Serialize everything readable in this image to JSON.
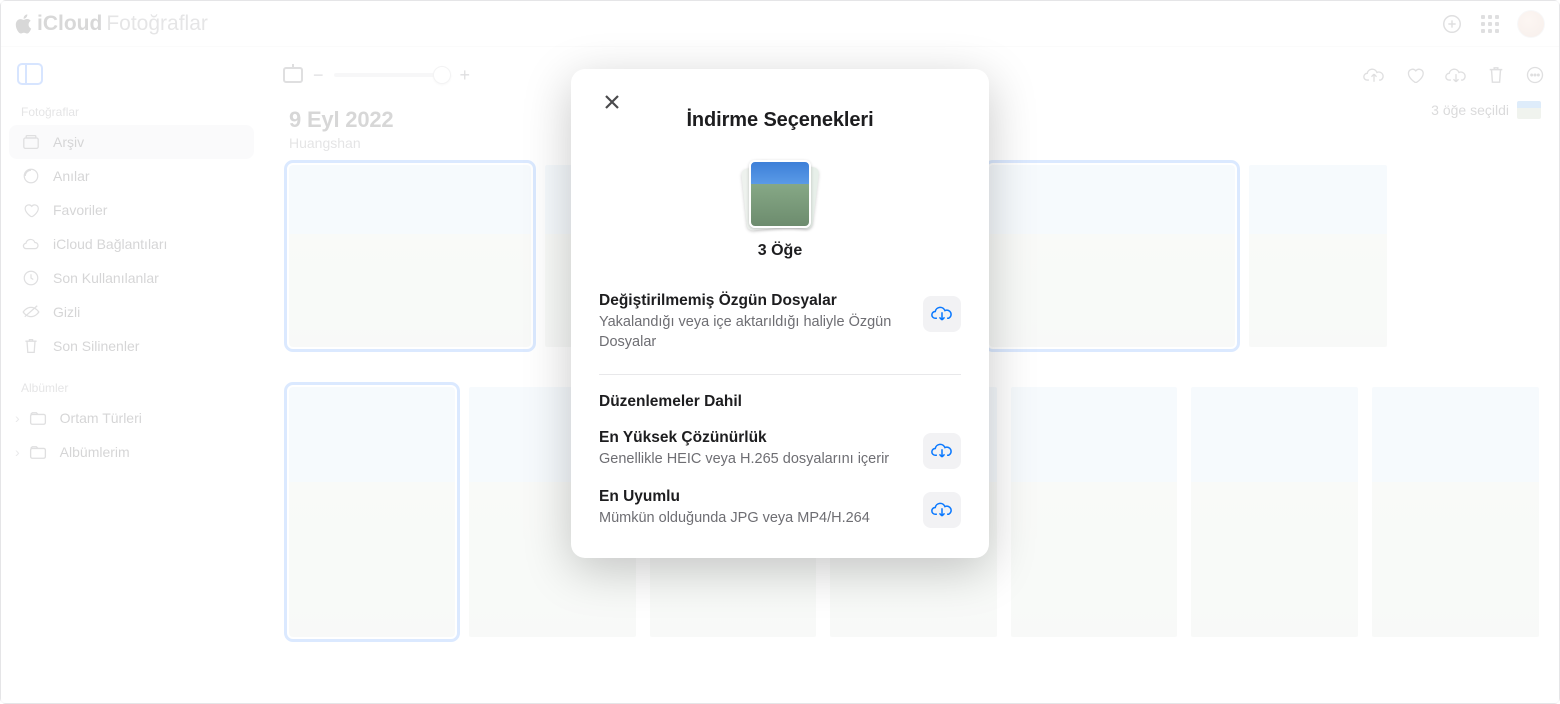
{
  "brand": {
    "cloud": "iCloud",
    "app": "Fotoğraflar"
  },
  "sidebar": {
    "section1": "Fotoğraflar",
    "items": [
      {
        "label": "Arşiv"
      },
      {
        "label": "Anılar"
      },
      {
        "label": "Favoriler"
      },
      {
        "label": "iCloud Bağlantıları"
      },
      {
        "label": "Son Kullanılanlar"
      },
      {
        "label": "Gizli"
      },
      {
        "label": "Son Silinenler"
      }
    ],
    "section2": "Albümler",
    "albums": [
      {
        "label": "Ortam Türleri"
      },
      {
        "label": "Albümlerim"
      }
    ]
  },
  "header": {
    "date": "9 Eyl 2022",
    "location": "Huangshan",
    "selection": "3 öğe seçildi"
  },
  "modal": {
    "title": "İndirme Seçenekleri",
    "count": "3 Öğe",
    "opt1_title": "Değiştirilmemiş Özgün Dosyalar",
    "opt1_sub": "Yakalandığı veya içe aktarıldığı haliyle Özgün Dosyalar",
    "section_label": "Düzenlemeler Dahil",
    "opt2_title": "En Yüksek Çözünürlük",
    "opt2_sub": "Genellikle HEIC veya H.265 dosyalarını içerir",
    "opt3_title": "En Uyumlu",
    "opt3_sub": "Mümkün olduğunda JPG veya MP4/H.264"
  }
}
